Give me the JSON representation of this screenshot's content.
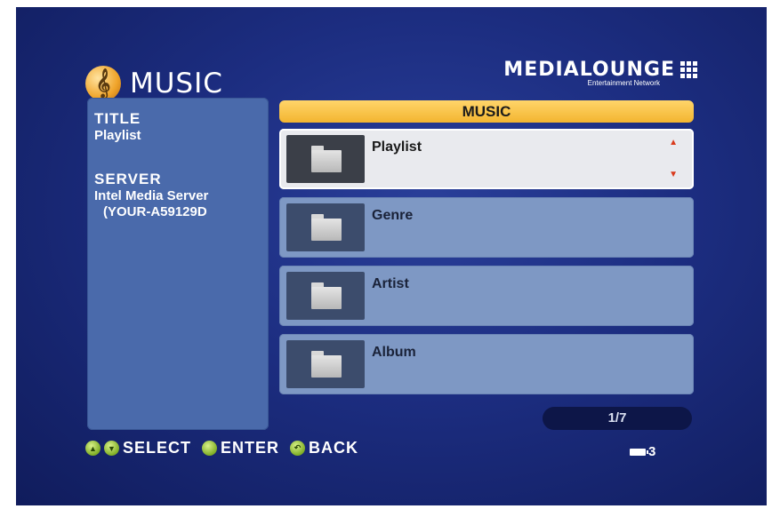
{
  "header": {
    "section_title": "MUSIC",
    "section_icon": "music-note-icon",
    "brand_name": "MEDIALOUNGE",
    "brand_sub": "Entertainment Network"
  },
  "info": {
    "title_label": "TITLE",
    "title_value": "Playlist",
    "server_label": "SERVER",
    "server_value_line1": "Intel Media Server",
    "server_value_line2": "(YOUR-A59129D"
  },
  "list": {
    "header": "MUSIC",
    "items": [
      {
        "label": "Playlist",
        "selected": true
      },
      {
        "label": "Genre",
        "selected": false
      },
      {
        "label": "Artist",
        "selected": false
      },
      {
        "label": "Album",
        "selected": false
      }
    ],
    "pager": "1/7"
  },
  "footer": {
    "select_label": "SELECT",
    "enter_label": "ENTER",
    "back_label": "BACK",
    "battery_count": "3"
  },
  "colors": {
    "background": "#1c2d80",
    "header_bar": "#f3b530",
    "panel": "#4a6aab",
    "item": "#7e98c4",
    "selected_item": "#e9eaee",
    "button_green": "#7fae25",
    "arrow": "#d93a1c"
  }
}
